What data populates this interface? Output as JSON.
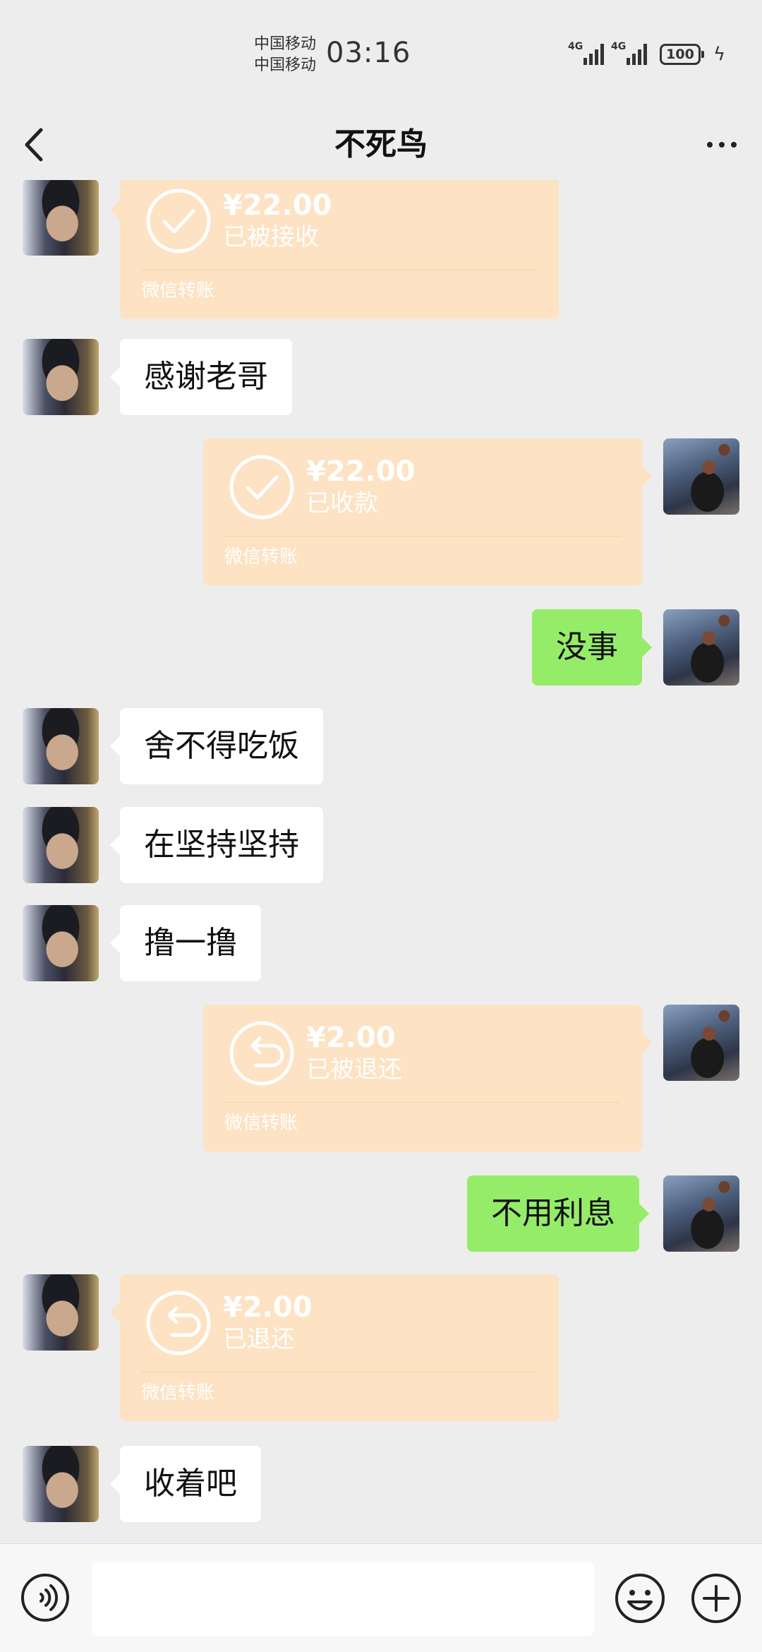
{
  "status_bar": {
    "carrier_1": "中国移动",
    "carrier_2": "中国移动",
    "time": "03:16",
    "network_1": "4G",
    "network_2": "4G",
    "battery": "100"
  },
  "header": {
    "title": "不死鸟"
  },
  "messages": [
    {
      "side": "left",
      "type": "transfer",
      "amount": "¥22.00",
      "status": "已被接收",
      "footer": "微信转账",
      "icon": "check-icon"
    },
    {
      "side": "left",
      "type": "text",
      "text": "感谢老哥"
    },
    {
      "side": "right",
      "type": "transfer",
      "amount": "¥22.00",
      "status": "已收款",
      "footer": "微信转账",
      "icon": "check-icon"
    },
    {
      "side": "right",
      "type": "text",
      "text": "没事"
    },
    {
      "side": "left",
      "type": "text",
      "text": "舍不得吃饭"
    },
    {
      "side": "left",
      "type": "text",
      "text": "在坚持坚持"
    },
    {
      "side": "left",
      "type": "text",
      "text": "撸一撸"
    },
    {
      "side": "right",
      "type": "transfer",
      "amount": "¥2.00",
      "status": "已被退还",
      "footer": "微信转账",
      "icon": "return-icon"
    },
    {
      "side": "right",
      "type": "text",
      "text": "不用利息"
    },
    {
      "side": "left",
      "type": "transfer",
      "amount": "¥2.00",
      "status": "已退还",
      "footer": "微信转账",
      "icon": "return-icon"
    },
    {
      "side": "left",
      "type": "text",
      "text": "收着吧"
    }
  ],
  "input_bar": {
    "message_value": "",
    "icons": [
      "voice-icon",
      "emoji-icon",
      "plus-icon"
    ]
  },
  "colors": {
    "background": "#ededed",
    "outgoing_bubble": "#95ec69",
    "incoming_bubble": "#ffffff",
    "transfer_card": "#fde2c3"
  }
}
